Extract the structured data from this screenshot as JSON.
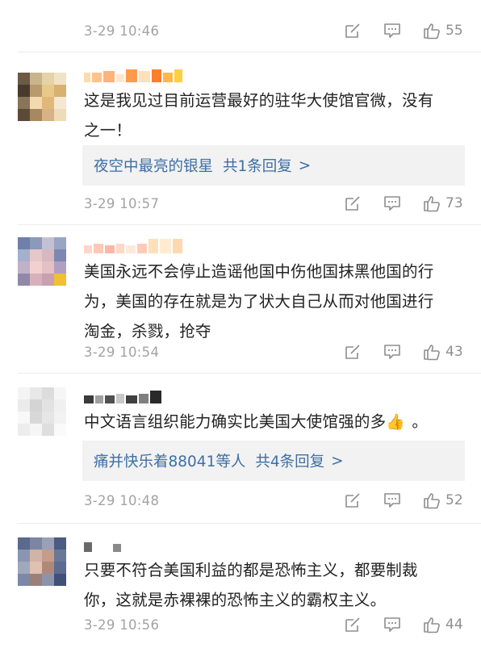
{
  "colors": {
    "link": "#3d6fa5",
    "meta": "#a3a3a3",
    "icon": "#8e8e8e",
    "reply_bg": "#f2f2f2"
  },
  "icons": {
    "edit": "edit-icon",
    "comment": "comment-icon",
    "like": "thumbs-up-icon",
    "emoji": "thumbs-up-emoji"
  },
  "top_item": {
    "time": "3-29 10:46",
    "likes": "55"
  },
  "comments": [
    {
      "text_lines": [
        "这是我见过目前运营最好的驻华大使馆官微，没有",
        "之一！"
      ],
      "reply": {
        "user": "夜空中最亮的银星",
        "summary": "共1条回复",
        "chevron": ">"
      },
      "time": "3-29 10:57",
      "likes": "73"
    },
    {
      "text_lines": [
        "美国永远不会停止造谣他国中伤他国抹黑他国的行",
        "为，美国的存在就是为了状大自己从而对他国进行",
        "淘金，杀戮，抢夺"
      ],
      "time": "3-29 10:54",
      "likes": "43"
    },
    {
      "text_lines": [
        "中文语言组织能力确实比美国大使馆强的多",
        "。"
      ],
      "reply": {
        "user": "痛并快乐着88041等人",
        "summary": "共4条回复",
        "chevron": ">"
      },
      "time": "3-29 10:48",
      "likes": "52"
    },
    {
      "text_lines": [
        "只要不符合美国利益的都是恐怖主义，都要制裁",
        "你，这就是赤裸裸的恐怖主义的霸权主义。"
      ],
      "time": "3-29 10:56",
      "likes": "44"
    }
  ]
}
